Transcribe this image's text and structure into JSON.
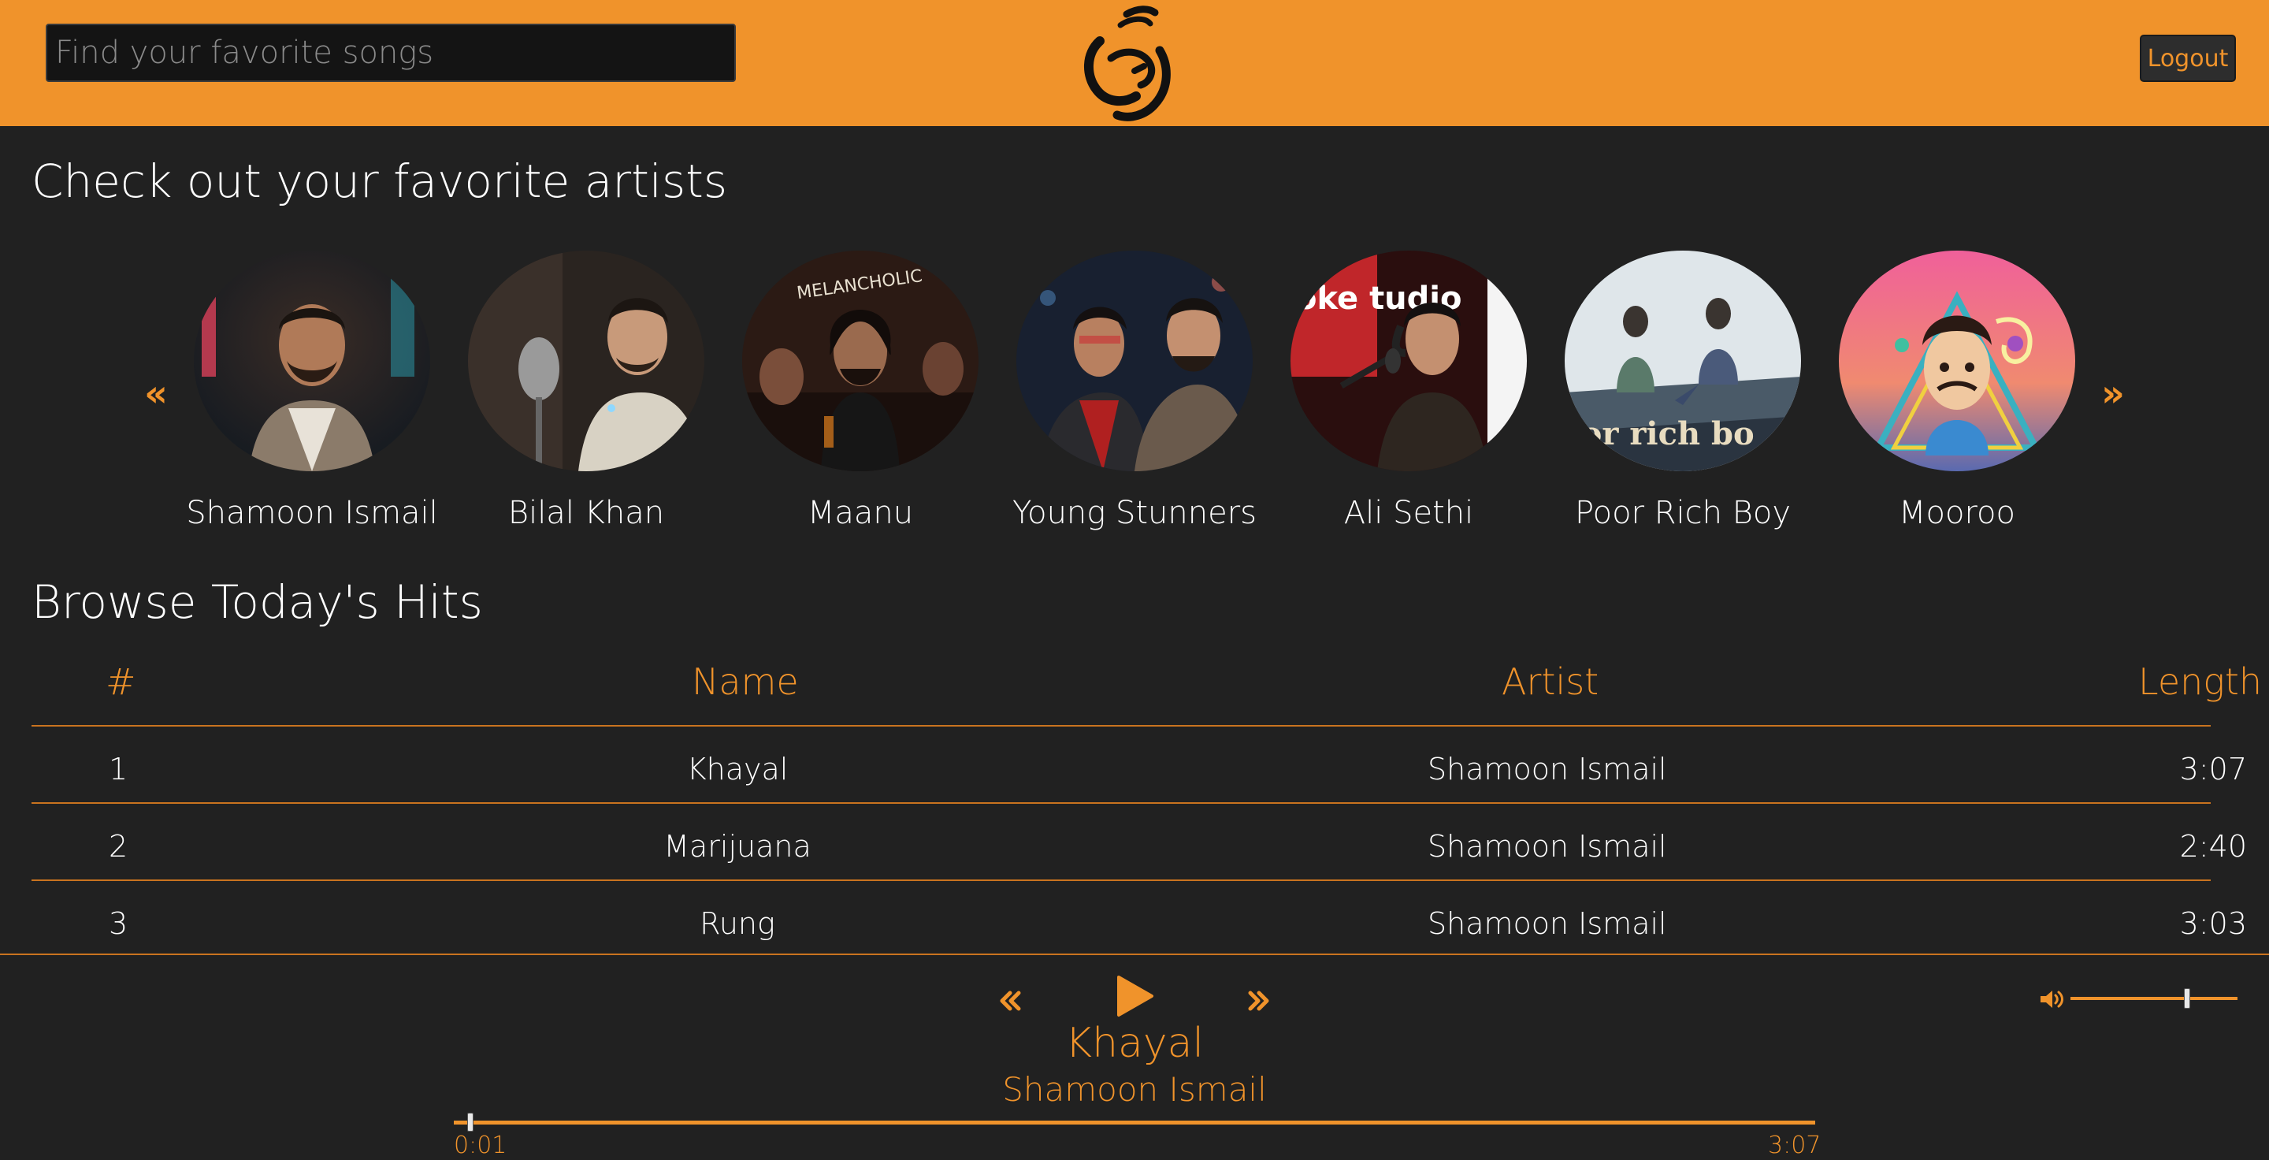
{
  "header": {
    "search_placeholder": "Find your favorite songs",
    "logout_label": "Logout"
  },
  "artists_section": {
    "title": "Check out your favorite artists",
    "prev_icon": "double-chevron-left-icon",
    "next_icon": "double-chevron-right-icon",
    "artists": [
      {
        "name": "Shamoon Ismail"
      },
      {
        "name": "Bilal Khan"
      },
      {
        "name": "Maanu"
      },
      {
        "name": "Young Stunners"
      },
      {
        "name": "Ali Sethi"
      },
      {
        "name": "Poor Rich Boy"
      },
      {
        "name": "Mooroo"
      }
    ],
    "photo_text": {
      "maanu": "MELANCHOLIC",
      "ali_sethi": "oke tudio",
      "poor_rich_boy": "oor rich bo"
    }
  },
  "hits_section": {
    "title": "Browse Today's Hits",
    "columns": {
      "number": "#",
      "name": "Name",
      "artist": "Artist",
      "length": "Length"
    },
    "rows": [
      {
        "number": "1",
        "name": "Khayal",
        "artist": "Shamoon Ismail",
        "length": "3:07"
      },
      {
        "number": "2",
        "name": "Marijuana",
        "artist": "Shamoon Ismail",
        "length": "2:40"
      },
      {
        "number": "3",
        "name": "Rung",
        "artist": "Shamoon Ismail",
        "length": "3:03"
      }
    ]
  },
  "player": {
    "title": "Khayal",
    "artist": "Shamoon Ismail",
    "current_time": "0:01",
    "total_time": "3:07",
    "progress": 0.005,
    "volume": 0.7,
    "icons": {
      "prev": "double-chevron-left-icon",
      "play": "play-icon",
      "next": "double-chevron-right-icon",
      "volume": "speaker-icon"
    }
  },
  "colors": {
    "accent": "#f0932b",
    "background": "#212121",
    "search_bg": "#141414"
  }
}
